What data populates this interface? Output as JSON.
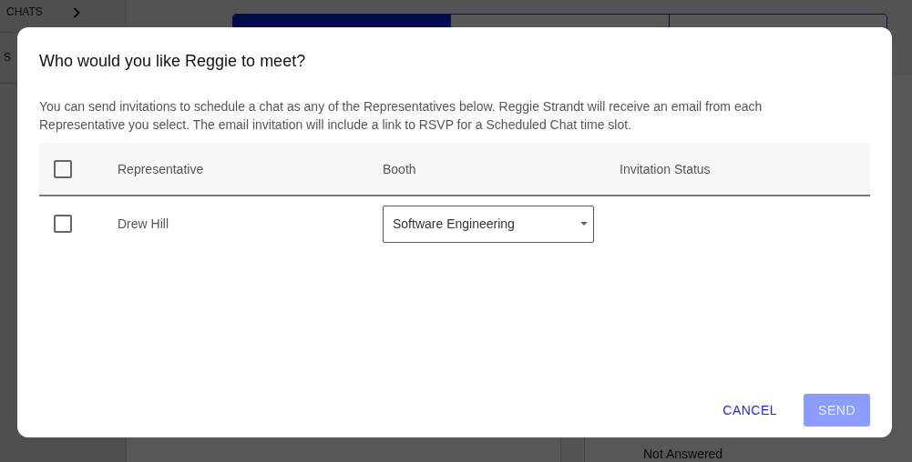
{
  "background": {
    "sidebar": {
      "items": [
        {
          "label": "CHATS",
          "kind": "link"
        },
        {
          "label": "S",
          "kind": "plain"
        }
      ]
    },
    "tabs": [
      {
        "selected": true
      },
      {
        "selected": false
      },
      {
        "selected": false
      }
    ],
    "status_text": "Not Answered"
  },
  "dialog": {
    "title": "Who would you like Reggie to meet?",
    "description": "You can send invitations to schedule a chat as any of the Representatives below. Reggie Strandt will receive an email from each Representative you select. The email invitation will include a link to RSVP for a Scheduled Chat time slot.",
    "table": {
      "select_all_checked": false,
      "columns": [
        "Representative",
        "Booth",
        "Invitation Status"
      ],
      "rows": [
        {
          "checked": false,
          "representative": "Drew Hill",
          "booth": "Software Engineering"
        }
      ]
    },
    "buttons": [
      {
        "label": "CANCEL",
        "kind": "text",
        "disabled": false
      },
      {
        "label": "SEND",
        "kind": "primary",
        "disabled": true
      }
    ]
  }
}
